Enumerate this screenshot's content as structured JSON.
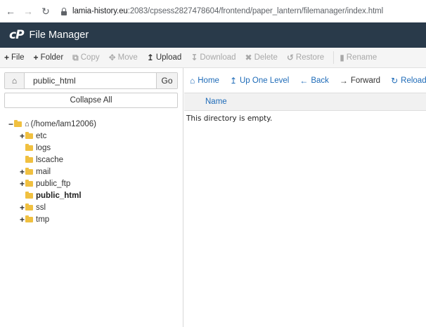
{
  "browser": {
    "url_host": "lamia-history.eu",
    "url_rest": ":2083/cpsess2827478604/frontend/paper_lantern/filemanager/index.html"
  },
  "header": {
    "logo": "cP",
    "title": "File Manager"
  },
  "toolbar": {
    "file": "File",
    "folder": "Folder",
    "copy": "Copy",
    "move": "Move",
    "upload": "Upload",
    "download": "Download",
    "delete": "Delete",
    "restore": "Restore",
    "rename": "Rename"
  },
  "left": {
    "path_value": "public_html",
    "go_label": "Go",
    "collapse_label": "Collapse All",
    "tree": {
      "root": "(/home/lam12006)",
      "items": [
        {
          "label": "etc",
          "toggle": "+"
        },
        {
          "label": "logs",
          "toggle": ""
        },
        {
          "label": "lscache",
          "toggle": ""
        },
        {
          "label": "mail",
          "toggle": "+"
        },
        {
          "label": "public_ftp",
          "toggle": "+"
        },
        {
          "label": "public_html",
          "toggle": ""
        },
        {
          "label": "ssl",
          "toggle": "+"
        },
        {
          "label": "tmp",
          "toggle": "+"
        }
      ]
    }
  },
  "right": {
    "nav": {
      "home": "Home",
      "up": "Up One Level",
      "back": "Back",
      "forward": "Forward",
      "reload": "Reload"
    },
    "column_name": "Name",
    "empty_message": "This directory is empty."
  },
  "colors": {
    "header_bg": "#293a4a",
    "link": "#1e6bb8",
    "folder": "#f0c040"
  }
}
